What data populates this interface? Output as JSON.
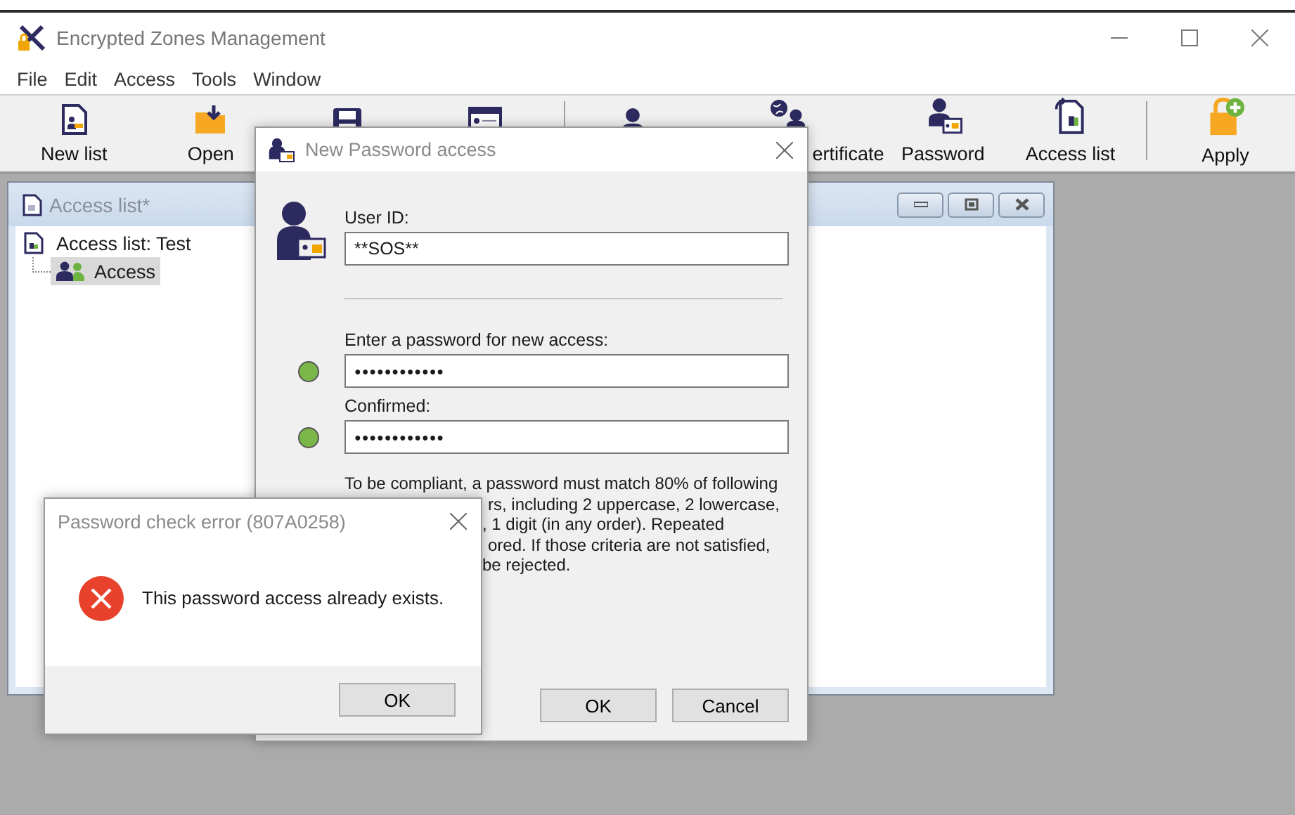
{
  "window": {
    "title": "Encrypted Zones Management"
  },
  "menu": [
    "File",
    "Edit",
    "Access",
    "Tools",
    "Window"
  ],
  "toolbar": [
    {
      "kind": "newlist",
      "label": "New list"
    },
    {
      "kind": "open",
      "label": "Open"
    },
    {
      "kind": "save"
    },
    {
      "kind": "form"
    },
    {
      "kind": "separator"
    },
    {
      "kind": "user"
    },
    {
      "kind": "certificate",
      "label": "ertificate"
    },
    {
      "kind": "password",
      "label": "Password"
    },
    {
      "kind": "accesslist",
      "label": "Access list"
    },
    {
      "kind": "separator"
    },
    {
      "kind": "apply",
      "label": "Apply"
    }
  ],
  "child_window": {
    "title": "Access list*",
    "tree": [
      {
        "label": "Access list: Test",
        "selected": false,
        "children": [
          {
            "label": "Access",
            "selected": true
          }
        ]
      }
    ]
  },
  "dialog": {
    "title": "New Password access",
    "user_id_label": "User ID:",
    "user_id": "**SOS**",
    "password_label": "Enter a password for new access:",
    "password": "●●●●●●●●●●●●",
    "password_valid": true,
    "confirm_label": "Confirmed:",
    "confirm": "●●●●●●●●●●●●",
    "confirm_valid": true,
    "help_lines": [
      "To be compliant, a password must match 80% of following",
      "rs, including 2 uppercase, 2 lowercase,",
      ", 1 digit (in any order). Repeated",
      "ored. If those criteria are not satisfied,",
      "be rejected."
    ],
    "buttons": [
      "OK",
      "Cancel"
    ]
  },
  "message_box": {
    "title": "Password check error (807A0258)",
    "message": "This password access already exists.",
    "button": "OK"
  }
}
